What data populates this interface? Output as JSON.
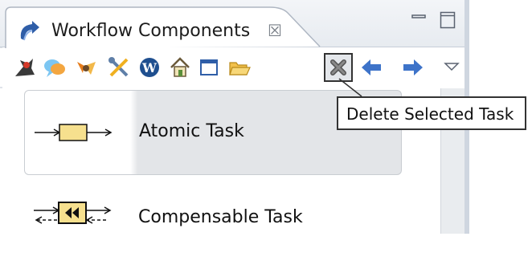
{
  "view": {
    "title": "Workflow Components",
    "close_glyph": "☒"
  },
  "toolbar": {
    "items": [
      {
        "name": "tool-1-icon"
      },
      {
        "name": "tool-2-icon"
      },
      {
        "name": "tool-3-icon"
      },
      {
        "name": "tool-4-icon"
      },
      {
        "name": "tool-5-icon"
      },
      {
        "name": "home-icon"
      },
      {
        "name": "window-icon"
      },
      {
        "name": "open-folder-icon"
      },
      {
        "name": "delete-icon",
        "pressed": true
      },
      {
        "name": "back-arrow-icon"
      },
      {
        "name": "forward-arrow-icon"
      },
      {
        "name": "view-menu-icon"
      }
    ]
  },
  "tooltip": {
    "text": "Delete Selected Task"
  },
  "palette": {
    "items": [
      {
        "label": "Atomic Task",
        "selected": true
      },
      {
        "label": "Compensable Task",
        "selected": false
      }
    ]
  },
  "colors": {
    "task_fill": "#f6e08e",
    "arrow_blue": "#3d73c9"
  }
}
